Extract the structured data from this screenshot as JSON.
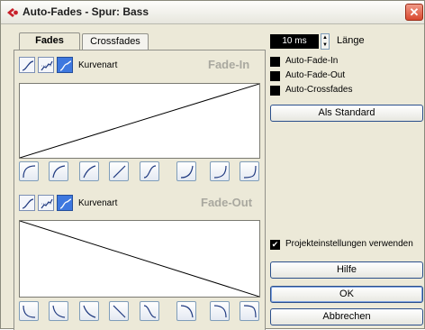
{
  "window": {
    "title": "Auto-Fades - Spur: Bass",
    "close_glyph": "✕"
  },
  "tabs": [
    {
      "label": "Fades",
      "active": true
    },
    {
      "label": "Crossfades",
      "active": false
    }
  ],
  "fade_in": {
    "curve_label": "Kurvenart",
    "section_label": "Fade-In",
    "curve_buttons": [
      "curve-spline-icon",
      "curve-damped-icon",
      "curve-linear-icon"
    ],
    "selected_curve": "curve-linear-icon"
  },
  "fade_out": {
    "curve_label": "Kurvenart",
    "section_label": "Fade-Out",
    "curve_buttons": [
      "curve-spline-icon",
      "curve-damped-icon",
      "curve-linear-icon"
    ],
    "selected_curve": "curve-linear-icon"
  },
  "length": {
    "value": "10 ms",
    "label": "Länge"
  },
  "options": [
    {
      "label": "Auto-Fade-In",
      "checked": false
    },
    {
      "label": "Auto-Fade-Out",
      "checked": false
    },
    {
      "label": "Auto-Crossfades",
      "checked": false
    }
  ],
  "buttons": {
    "as_default": "Als Standard",
    "help": "Hilfe",
    "ok": "OK",
    "cancel": "Abbrechen"
  },
  "project_settings": {
    "label": "Projekteinstellungen verwenden",
    "checked": true,
    "check_glyph": "✔"
  },
  "colors": {
    "dialog_bg": "#ece9d8",
    "selected_button": "#3e78df",
    "section_label": "#a9a89f"
  }
}
